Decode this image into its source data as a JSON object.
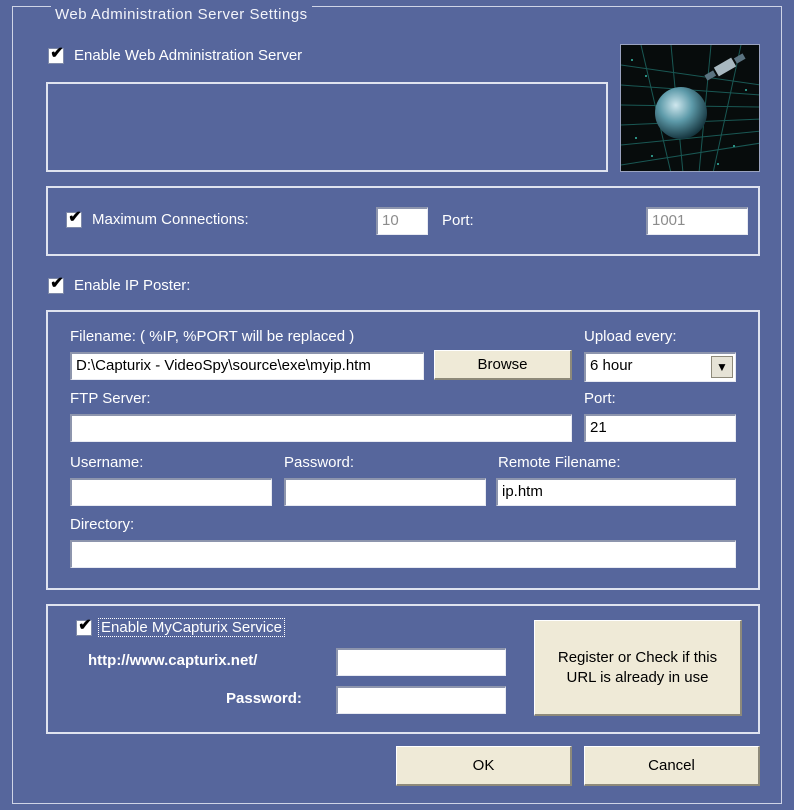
{
  "window": {
    "title": "Web Administration Server Settings"
  },
  "web_admin": {
    "enable_label": "Enable Web Administration Server",
    "enabled": true
  },
  "connections": {
    "max_label": "Maximum Connections:",
    "max_enabled": true,
    "max_value": "10",
    "port_label": "Port:",
    "port_value": "1001"
  },
  "ip_poster": {
    "enable_label": "Enable IP Poster:",
    "enabled": true,
    "filename_label": "Filename: ( %IP, %PORT will be replaced )",
    "filename_value": "D:\\Capturix - VideoSpy\\source\\exe\\myip.htm",
    "browse_label": "Browse",
    "upload_label": "Upload every:",
    "upload_value": "6 hour",
    "ftp_label": "FTP Server:",
    "ftp_value": "",
    "port_label": "Port:",
    "port_value": "21",
    "username_label": "Username:",
    "username_value": "",
    "password_label": "Password:",
    "password_value": "",
    "remote_label": "Remote Filename:",
    "remote_value": "ip.htm",
    "directory_label": "Directory:",
    "directory_value": ""
  },
  "mycapturix": {
    "enable_label": "Enable MyCapturix Service",
    "enabled": true,
    "url_label": "http://www.capturix.net/",
    "url_value": "",
    "password_label": "Password:",
    "password_value": "",
    "register_label": "Register or Check if this URL is already in use"
  },
  "footer": {
    "ok_label": "OK",
    "cancel_label": "Cancel"
  },
  "icons": {
    "check": "✔",
    "dropdown": "▼",
    "globe": "globe-image"
  }
}
